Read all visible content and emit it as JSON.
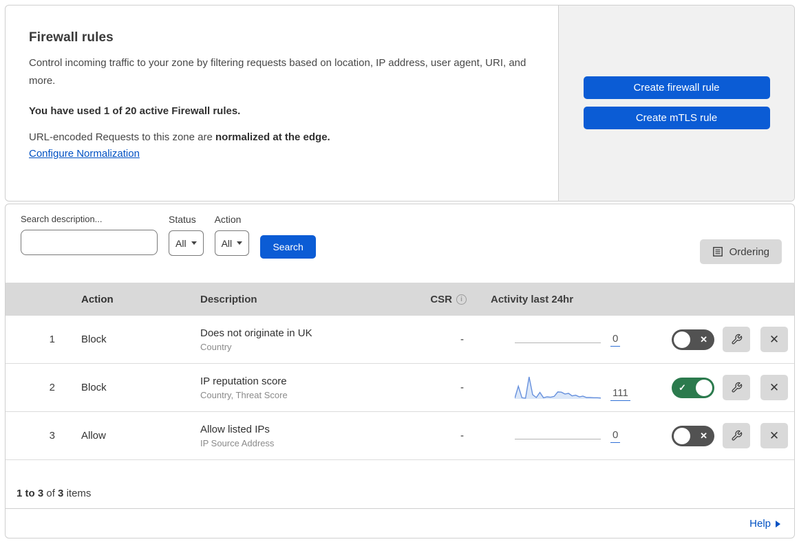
{
  "header": {
    "title": "Firewall rules",
    "description": "Control incoming traffic to your zone by filtering requests based on location, IP address, user agent, URI, and more.",
    "usage_text": "You have used 1 of 20 active Firewall rules.",
    "normalization_prefix": "URL-encoded Requests to this zone are ",
    "normalization_bold": "normalized at the edge.",
    "normalization_link": "Configure Normalization",
    "buttons": {
      "create_firewall": "Create firewall rule",
      "create_mtls": "Create mTLS rule"
    }
  },
  "filters": {
    "search_label": "Search description...",
    "search_value": "",
    "status_label": "Status",
    "status_value": "All",
    "action_label": "Action",
    "action_value": "All",
    "search_button": "Search",
    "ordering_button": "Ordering"
  },
  "table": {
    "headers": {
      "action": "Action",
      "description": "Description",
      "csr": "CSR",
      "csr_info_glyph": "i",
      "activity": "Activity last 24hr"
    },
    "rows": [
      {
        "index": "1",
        "action": "Block",
        "description": "Does not originate in UK",
        "criteria": "Country",
        "csr": "-",
        "activity_count": "0",
        "enabled": false,
        "sparkline": []
      },
      {
        "index": "2",
        "action": "Block",
        "description": "IP reputation score",
        "criteria": "Country, Threat Score",
        "csr": "-",
        "activity_count": "111",
        "enabled": true,
        "sparkline": [
          3,
          55,
          5,
          3,
          95,
          18,
          6,
          28,
          5,
          9,
          7,
          11,
          30,
          29,
          21,
          24,
          13,
          16,
          9,
          12,
          6,
          6,
          5,
          5,
          4
        ]
      },
      {
        "index": "3",
        "action": "Allow",
        "description": "Allow listed IPs",
        "criteria": "IP Source Address",
        "csr": "-",
        "activity_count": "0",
        "enabled": false,
        "sparkline": []
      }
    ]
  },
  "icons": {
    "toggle_on_glyph": "✓",
    "toggle_off_glyph": "✕",
    "close_glyph": "✕"
  },
  "footer": {
    "range_bold": "1 to 3",
    "of_text": "of",
    "total_bold": "3",
    "items_text": "items",
    "help_label": "Help"
  },
  "colors": {
    "accent_blue": "#0b5cd5",
    "link_blue": "#0051c3",
    "toggle_on_green": "#2b7a4d",
    "toggle_off_gray": "#525252",
    "table_header_gray": "#d9d9d9",
    "panel_gray": "#f1f1f1",
    "sparkline_blue": "#6690dd",
    "sparkline_fill": "#dbe7f8"
  }
}
